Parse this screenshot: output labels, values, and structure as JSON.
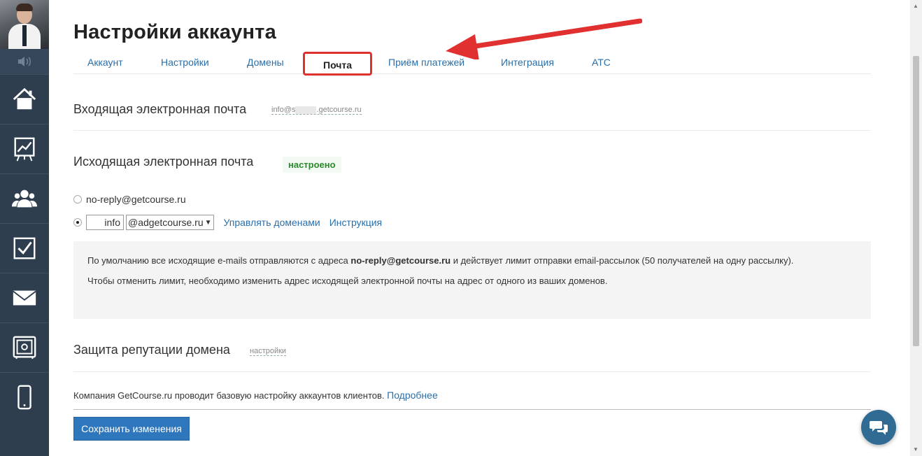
{
  "page": {
    "title": "Настройки аккаунта"
  },
  "tabs": [
    {
      "label": "Аккаунт"
    },
    {
      "label": "Настройки"
    },
    {
      "label": "Домены"
    },
    {
      "label": "Почта"
    },
    {
      "label": "Приём платежей"
    },
    {
      "label": "Интеграция"
    },
    {
      "label": "АТС"
    }
  ],
  "incoming": {
    "title": "Входящая электронная почта",
    "address_left": "info@s",
    "address_right": ".getcourse.ru"
  },
  "outgoing": {
    "title": "Исходящая электронная почта",
    "status": "настроено",
    "option1_label": "no-reply@getcourse.ru",
    "local_part": "info",
    "domain_selected": "@adgetcourse.ru",
    "manage_domains_link": "Управлять доменами",
    "instruction_link": "Инструкция"
  },
  "info_box": {
    "line1_before": "По умолчанию все исходящие e-mails отправляются с адреса ",
    "line1_bold": "no-reply@getcourse.ru",
    "line1_after": " и действует лимит отправки email-рассылок (50 получателей на одну рассылку).",
    "line2": "Чтобы отменить лимит, необходимо изменить адрес исходящей электронной почты на адрес от одного из ваших доменов."
  },
  "reputation": {
    "title": "Защита репутации домена",
    "settings_link": "настройки",
    "note": "Компания GetCourse.ru проводит базовую настройку аккаунтов клиентов. ",
    "more_link": "Подробнее"
  },
  "save_button": "Сохранить изменения",
  "icons": [
    "speaker-icon",
    "home-icon",
    "chart-icon",
    "users-icon",
    "checkbox-icon",
    "mail-icon",
    "safe-icon",
    "phone-icon",
    "chat-icon"
  ],
  "colors": {
    "sidebar": "#2e3e4e",
    "link": "#2a6ea8",
    "highlight": "#e03030",
    "success": "#2a8a2a",
    "button": "#2f77bc"
  }
}
